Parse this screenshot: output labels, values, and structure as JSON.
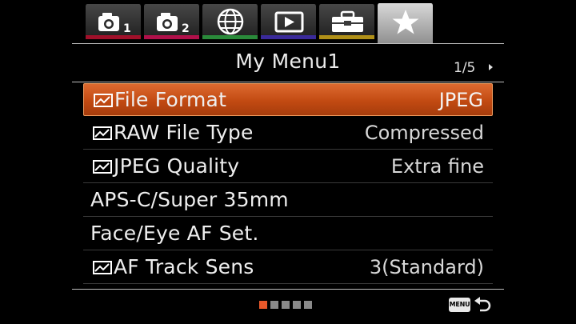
{
  "tabs": [
    {
      "name": "camera-settings-1",
      "icon": "camera-icon",
      "number": "1",
      "stripe_color": "#a0102a",
      "active": false
    },
    {
      "name": "camera-settings-2",
      "icon": "camera-icon",
      "number": "2",
      "stripe_color": "#b0104a",
      "active": false
    },
    {
      "name": "network",
      "icon": "globe-icon",
      "stripe_color": "#2a8a3a",
      "active": false
    },
    {
      "name": "playback",
      "icon": "playback-icon",
      "stripe_color": "#3a2a9a",
      "active": false
    },
    {
      "name": "setup",
      "icon": "toolbox-icon",
      "stripe_color": "#b09018",
      "active": false
    },
    {
      "name": "my-menu",
      "icon": "star-icon",
      "active": true
    }
  ],
  "header": {
    "title": "My Menu1",
    "page_indicator": "1/5"
  },
  "menu": {
    "items": [
      {
        "label": "File Format",
        "value": "JPEG",
        "has_icon": true,
        "selected": true
      },
      {
        "label": "RAW File Type",
        "value": "Compressed",
        "has_icon": true,
        "selected": false
      },
      {
        "label": "JPEG Quality",
        "value": "Extra fine",
        "has_icon": true,
        "selected": false
      },
      {
        "label": "APS-C/Super 35mm",
        "value": "",
        "has_icon": false,
        "selected": false
      },
      {
        "label": "Face/Eye AF Set.",
        "value": "",
        "has_icon": false,
        "selected": false
      },
      {
        "label": "AF Track Sens",
        "value": "3(Standard)",
        "has_icon": true,
        "selected": false
      }
    ]
  },
  "footer": {
    "page_dots": {
      "total": 5,
      "current": 1
    },
    "menu_button_label": "MENU",
    "back_icon": "return-arrow-icon"
  },
  "colors": {
    "selection": "#c24a12",
    "active_dot": "#e8582a",
    "inactive_dot": "#8a8a8a"
  }
}
